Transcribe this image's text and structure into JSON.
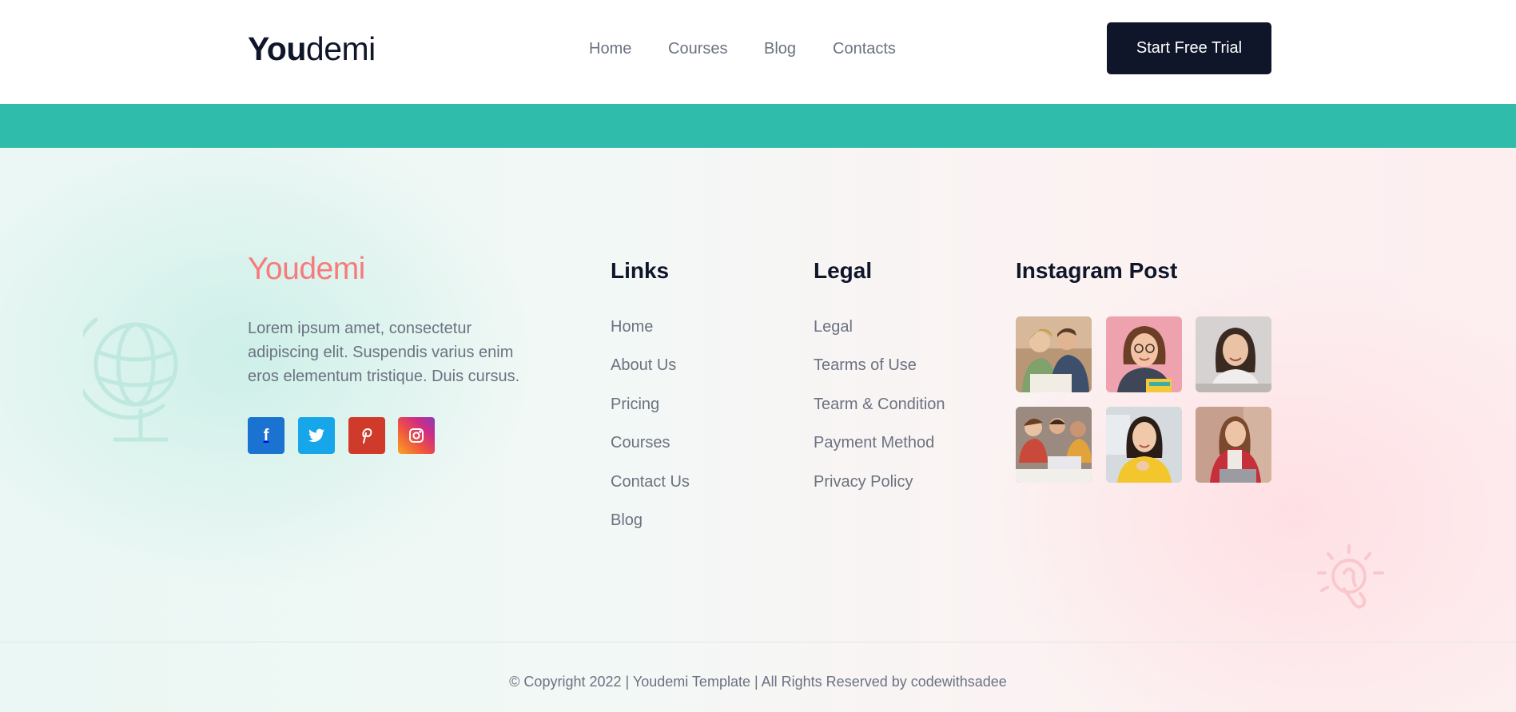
{
  "header": {
    "logo": {
      "bold": "You",
      "light": "demi"
    },
    "nav": [
      "Home",
      "Courses",
      "Blog",
      "Contacts"
    ],
    "cta_label": "Start Free Trial"
  },
  "colors": {
    "dark": "#0f1629",
    "teal": "#2fbcab",
    "coral": "#f57c7c",
    "text_muted": "#6b7280"
  },
  "footer": {
    "logo": {
      "bold": "You",
      "light": "demi"
    },
    "description": "Lorem ipsum amet, consectetur adipiscing elit. Suspendis varius enim eros elementum tristique. Duis cursus.",
    "social": [
      {
        "name": "facebook-icon",
        "glyph": "f"
      },
      {
        "name": "twitter-icon",
        "glyph": ""
      },
      {
        "name": "pinterest-icon",
        "glyph": ""
      },
      {
        "name": "instagram-icon",
        "glyph": ""
      }
    ],
    "links": {
      "title": "Links",
      "items": [
        "Home",
        "About Us",
        "Pricing",
        "Courses",
        "Contact Us",
        "Blog"
      ]
    },
    "legal": {
      "title": "Legal",
      "items": [
        "Legal",
        "Tearms of Use",
        "Tearm & Condition",
        "Payment Method",
        "Privacy Policy"
      ]
    },
    "instagram": {
      "title": "Instagram Post",
      "posts": [
        "instagram-post-students-laptop",
        "instagram-post-woman-glasses",
        "instagram-post-woman-smiling",
        "instagram-post-group-study",
        "instagram-post-woman-yellow",
        "instagram-post-woman-red-jacket"
      ]
    },
    "copyright": "© Copyright 2022 | Youdemi Template | All Rights Reserved by codewithsadee"
  }
}
